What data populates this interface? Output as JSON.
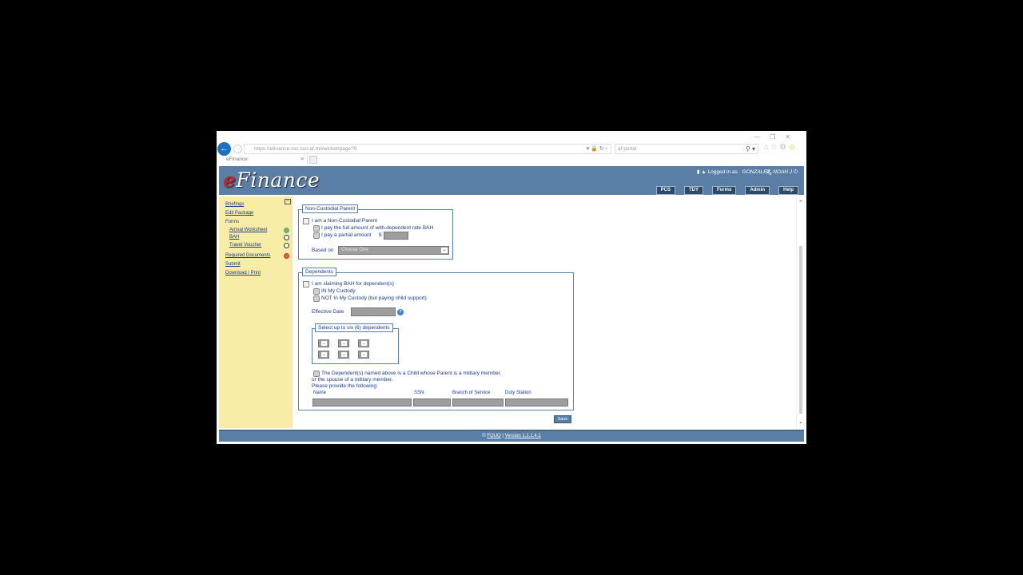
{
  "browser": {
    "url": "https://efinance.ssc.sso.af.mil/wicket/page?9",
    "search_text": "af portal",
    "tab_title": "eFinance"
  },
  "header": {
    "logo_e": "e",
    "logo_rest": "Finance",
    "logged_in_label": "Logged in as",
    "user_name": "GONZALEZ, NOAH J",
    "nav": [
      "PCS",
      "TDY",
      "Forms",
      "Admin",
      "Help"
    ]
  },
  "sidebar": {
    "briefings": "Briefings",
    "edit_package": "Edit Package",
    "forms_label": "Forms",
    "arrival_worksheet": "Arrival Worksheet",
    "bah": "BAH",
    "travel_voucher": "Travel Voucher",
    "required_documents": "Required Documents",
    "submit": "Submit",
    "download_print": "Download / Print"
  },
  "non_custodial": {
    "legend": "Non-Custodial Parent",
    "checkbox_label": "I am a Non-Custodial Parent",
    "opt_full": "I pay the full amount of with-dependent rate BAH",
    "opt_partial": "I pay a partial amount",
    "currency": "$",
    "based_on_label": "Based on",
    "based_on_value": "Choose One"
  },
  "dependents": {
    "legend": "Dependents",
    "checkbox_label": "I am claiming BAH for dependent(s)",
    "opt_in_custody": "IN My Custody",
    "opt_not_custody": "NOT In My Custody (but paying child support)",
    "effective_date_label": "Effective Date",
    "select_legend": "Select up to six (6) dependents",
    "military_line1": "The Dependent(s) named above is a Child whose Parent is a military member,",
    "military_line2": "or the spouse of a military member.",
    "military_line3": "Please provide the following:",
    "columns": [
      "Name",
      "SSN",
      "Branch of Service",
      "Duty Station"
    ],
    "save_label": "Save"
  },
  "footer": {
    "fouo": "FOUO",
    "separator": "|",
    "version": "Version 1.1.1.4.1"
  },
  "colors": {
    "header_blue": "#5a7fa6",
    "sidebar_yellow": "#f8eda6",
    "logo_red": "#c1272d"
  }
}
